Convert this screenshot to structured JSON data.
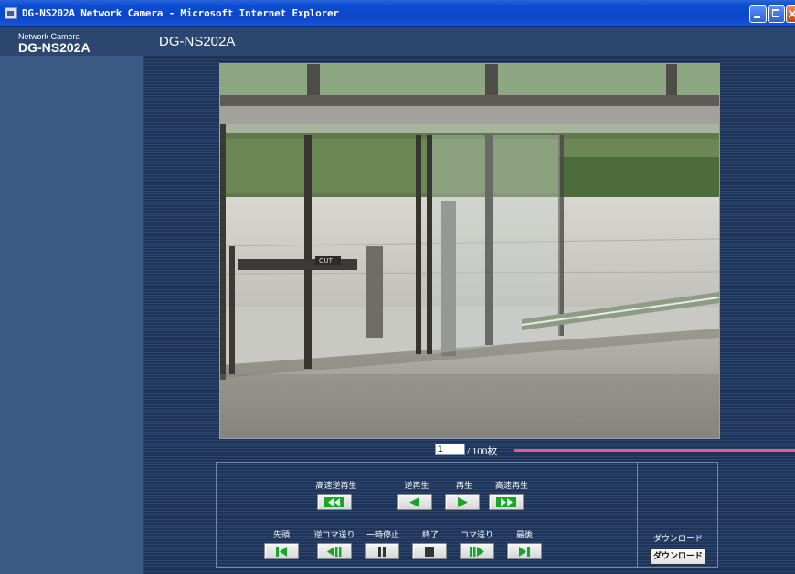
{
  "window": {
    "title": "DG-NS202A Network Camera - Microsoft Internet Explorer",
    "controls": [
      "minimize",
      "maximize",
      "close"
    ]
  },
  "brand": {
    "subtitle": "Network Camera",
    "model": "DG-NS202A"
  },
  "page": {
    "camera_title": "DG-NS202A"
  },
  "image": {
    "description_icon": "camera-image"
  },
  "counter": {
    "current": "1",
    "total_label": "/ 100枚"
  },
  "playback": {
    "row1": [
      {
        "label": "高速逆再生",
        "icon": "fast-rewind-icon"
      },
      {
        "label": "逆再生",
        "icon": "reverse-play-icon"
      },
      {
        "label": "再生",
        "icon": "play-icon"
      },
      {
        "label": "高速再生",
        "icon": "fast-forward-icon"
      }
    ],
    "row2": [
      {
        "label": "先頭",
        "icon": "skip-first-icon"
      },
      {
        "label": "逆コマ送り",
        "icon": "step-back-icon"
      },
      {
        "label": "一時停止",
        "icon": "pause-icon"
      },
      {
        "label": "終了",
        "icon": "stop-icon"
      },
      {
        "label": "コマ送り",
        "icon": "step-forward-icon"
      },
      {
        "label": "最後",
        "icon": "skip-last-icon"
      }
    ]
  },
  "download": {
    "label": "ダウンロード",
    "button_label": "ダウンロード"
  },
  "colors": {
    "icon_green": "#1aa52a",
    "panel_blue": "#3c5a84",
    "progress_pink": "#d8609a"
  }
}
